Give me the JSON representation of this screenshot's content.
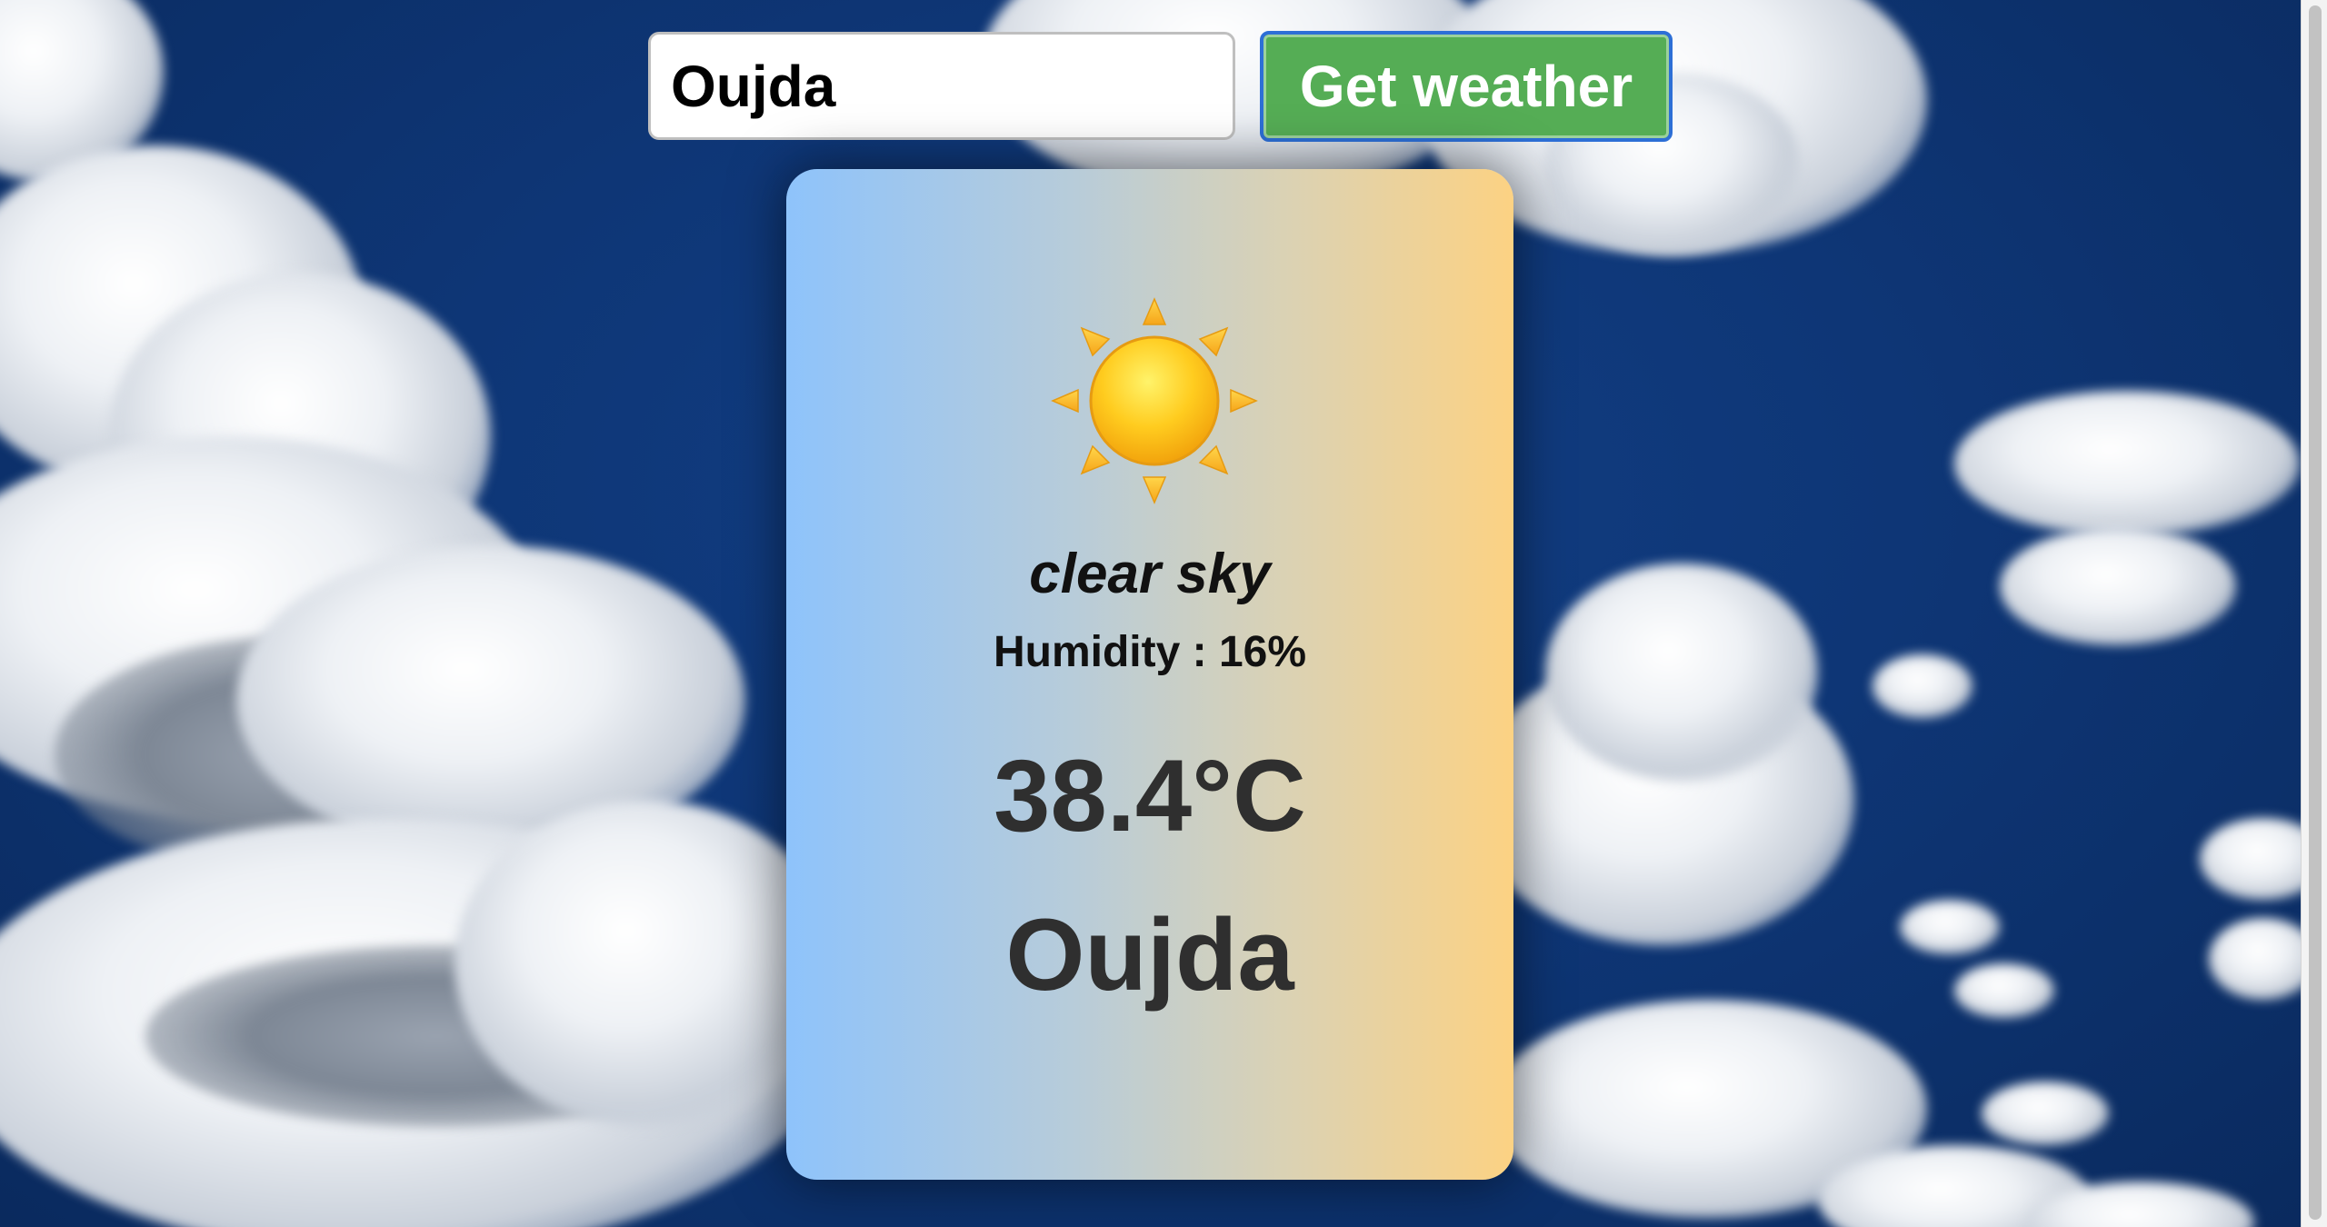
{
  "search": {
    "value": "Oujda",
    "button_label": "Get weather"
  },
  "weather": {
    "icon": "sun-icon",
    "description": "clear sky",
    "humidity_label": "Humidity : ",
    "humidity_value": "16%",
    "temperature": "38.4°C",
    "city": "Oujda"
  },
  "colors": {
    "button_bg": "#55ad55",
    "button_border": "#2d6fd6",
    "card_gradient_start": "#8ec3fb",
    "card_gradient_end": "#fcd283",
    "sky": "#0e3676"
  }
}
